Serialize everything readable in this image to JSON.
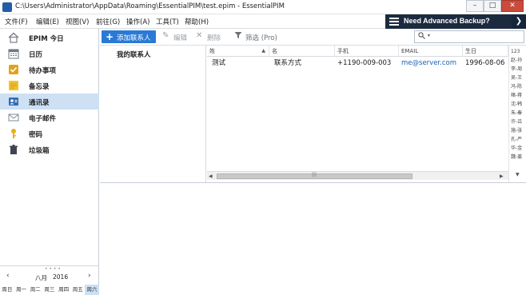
{
  "window": {
    "title": "C:\\Users\\Administrator\\AppData\\Roaming\\EssentialPIM\\test.epim - EssentialPIM",
    "minimize_glyph": "–",
    "maximize_glyph": "□",
    "close_glyph": "✕"
  },
  "menu": [
    {
      "label": "文件(F)"
    },
    {
      "label": "编辑(E)"
    },
    {
      "label": "视图(V)"
    },
    {
      "label": "前往(G)"
    },
    {
      "label": "操作(A)"
    },
    {
      "label": "工具(T)"
    },
    {
      "label": "帮助(H)"
    }
  ],
  "promo": {
    "text": "Need Advanced Backup?",
    "arrow": "❯"
  },
  "sidebar": {
    "items": [
      {
        "label": "EPIM 今日",
        "icon": "home-icon",
        "color": "#7a7f86"
      },
      {
        "label": "日历",
        "icon": "calendar-icon",
        "color": "#6d7784"
      },
      {
        "label": "待办事项",
        "icon": "todo-icon",
        "color": "#e0a21b"
      },
      {
        "label": "备忘录",
        "icon": "notes-icon",
        "color": "#f2c230"
      },
      {
        "label": "通讯录",
        "icon": "contacts-icon",
        "color": "#2f6db5"
      },
      {
        "label": "电子邮件",
        "icon": "email-icon",
        "color": "#7d8a99"
      },
      {
        "label": "密码",
        "icon": "key-icon",
        "color": "#e3b21c"
      },
      {
        "label": "垃圾箱",
        "icon": "trash-icon",
        "color": "#3d4650"
      }
    ],
    "active_index": 4
  },
  "calendar": {
    "prev": "‹",
    "next": "›",
    "month": "八月",
    "year": "2016",
    "days": [
      "周日",
      "周一",
      "周二",
      "周三",
      "周四",
      "周五",
      "周六"
    ],
    "selected_day_index": 6
  },
  "toolbar": {
    "add_label": "添加联系人",
    "edit_label": "编辑",
    "delete_label": "删除",
    "filter_label": "筛选 (Pro)"
  },
  "search": {
    "value": "",
    "placeholder": ""
  },
  "groups": {
    "items": [
      {
        "label": "我的联系人"
      }
    ]
  },
  "table": {
    "columns": [
      "姓",
      "名",
      "手机",
      "EMAIL",
      "生日"
    ],
    "sorted_column_index": 0,
    "rows": [
      {
        "last": "测试",
        "first": "联系方式",
        "mobile": "+1190-009-003",
        "email": "me@server.com",
        "birthday": "1996-08-06"
      }
    ]
  },
  "alphabet_index": [
    "123",
    "赵-孙",
    "李-周",
    "吴-王",
    "冯-陈",
    "楮-蒋",
    "沈-韩",
    "朱-秦",
    "许-吕",
    "施-张",
    "孔-严",
    "华-金",
    "魏-姜"
  ],
  "colors": {
    "accent": "#2a7ad5",
    "selected": "#cde0f4",
    "promo_bg": "#1b2a3e",
    "link": "#1a5fb4"
  }
}
